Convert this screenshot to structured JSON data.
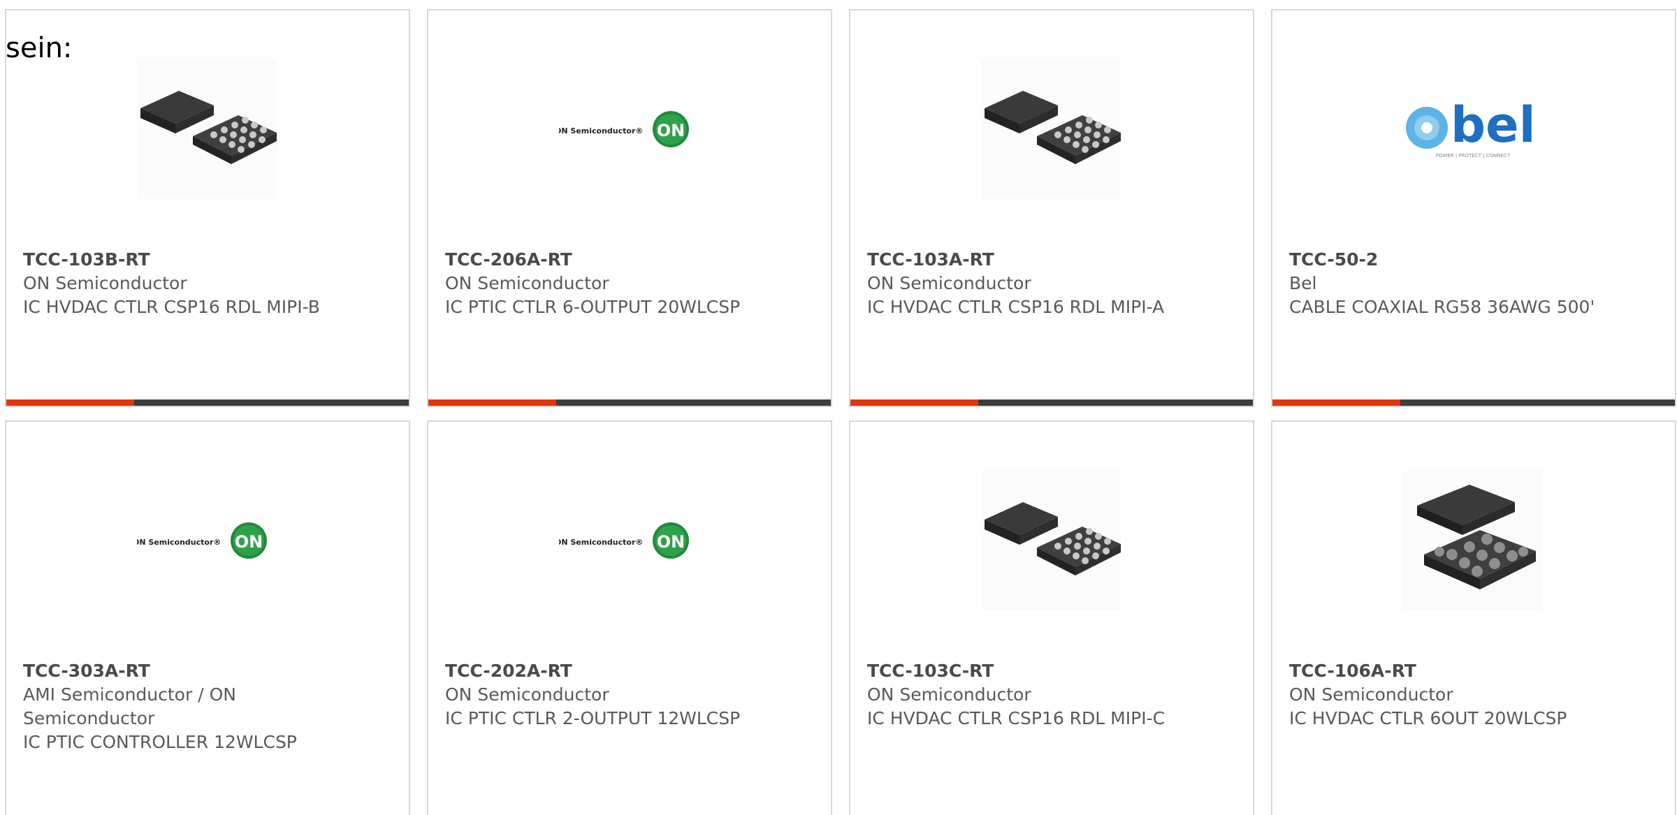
{
  "intro_text": "sein:",
  "accent_color": "#e0360c",
  "bar_color": "#3d3d3d",
  "products": [
    {
      "part_number": "TCC-103B-RT",
      "manufacturer": "ON Semiconductor",
      "description": "IC HVDAC CTLR CSP16 RDL MIPI-B",
      "image": "chip-package-icon"
    },
    {
      "part_number": "TCC-206A-RT",
      "manufacturer": "ON Semiconductor",
      "description": "IC PTIC CTLR 6-OUTPUT 20WLCSP",
      "image": "on-semiconductor-logo",
      "logo_text": "ON Semiconductor®",
      "logo_badge": "ON"
    },
    {
      "part_number": "TCC-103A-RT",
      "manufacturer": "ON Semiconductor",
      "description": "IC HVDAC CTLR CSP16 RDL MIPI-A",
      "image": "chip-package-icon"
    },
    {
      "part_number": "TCC-50-2",
      "manufacturer": "Bel",
      "description": "CABLE COAXIAL RG58 36AWG 500'",
      "image": "bel-logo",
      "logo_text": "bel",
      "logo_tagline": "POWER | PROTECT | CONNECT"
    },
    {
      "part_number": "TCC-303A-RT",
      "manufacturer": "AMI Semiconductor / ON Semiconductor",
      "description": "IC PTIC CONTROLLER 12WLCSP",
      "image": "on-semiconductor-logo",
      "logo_text": "ON Semiconductor®",
      "logo_badge": "ON"
    },
    {
      "part_number": "TCC-202A-RT",
      "manufacturer": "ON Semiconductor",
      "description": "IC PTIC CTLR 2-OUTPUT 12WLCSP",
      "image": "on-semiconductor-logo",
      "logo_text": "ON Semiconductor®",
      "logo_badge": "ON"
    },
    {
      "part_number": "TCC-103C-RT",
      "manufacturer": "ON Semiconductor",
      "description": "IC HVDAC CTLR CSP16 RDL MIPI-C",
      "image": "chip-package-icon"
    },
    {
      "part_number": "TCC-106A-RT",
      "manufacturer": "ON Semiconductor",
      "description": "IC HVDAC CTLR 6OUT 20WLCSP",
      "image": "chip-package-large-icon"
    }
  ]
}
